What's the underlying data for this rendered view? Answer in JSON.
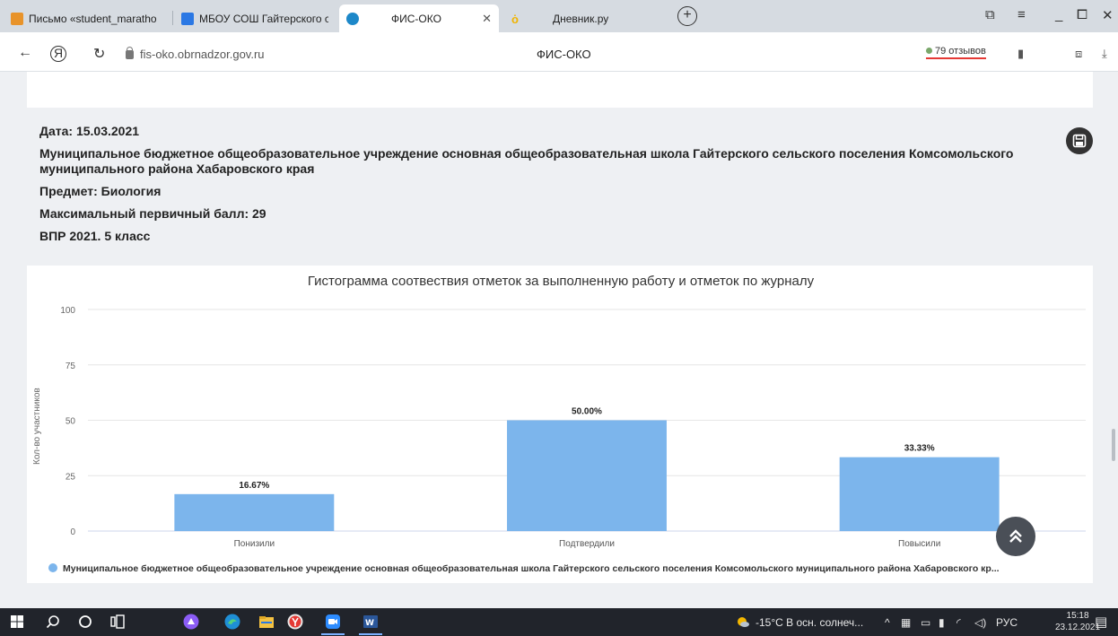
{
  "browser": {
    "tabs": [
      {
        "label": "Письмо «student_maratho",
        "color": "#e8932a"
      },
      {
        "label": "МБОУ СОШ Гайтерского с",
        "color": "#2b78e4"
      },
      {
        "label": "ФИС-ОКО",
        "color": "#1d88c9"
      },
      {
        "label": "Дневник.ру",
        "color": "#f0b400"
      }
    ],
    "url": "fis-oko.obrnadzor.gov.ru",
    "page_title": "ФИС-ОКО",
    "reviews": "79 отзывов"
  },
  "report": {
    "date": "Дата: 15.03.2021",
    "org": "Муниципальное бюджетное общеобразовательное учреждение основная общеобразовательная школа Гайтерского сельского поселения Комсомольского муниципального района Хабаровского края",
    "subject": "Предмет: Биология",
    "max_score": "Максимальный первичный балл: 29",
    "test": "ВПР 2021. 5 класс"
  },
  "chart_data": {
    "type": "bar",
    "title": "Гистограмма соотвествия отметок за выполненную работу и отметок по журналу",
    "ylabel": "Кол-во участников",
    "categories": [
      "Понизили",
      "Подтвердили",
      "Повысили"
    ],
    "series": [
      {
        "name": "Муниципальное бюджетное общеобразовательное учреждение основная общеобразовательная школа Гайтерского сельского поселения Комсомольского муниципального района Хабаровского кр...",
        "values": [
          16.67,
          50.0,
          33.33
        ],
        "labels": [
          "16.67%",
          "50.00%",
          "33.33%"
        ],
        "color": "#7cb5ec"
      }
    ],
    "ylim": [
      0,
      100
    ],
    "yticks": [
      "0",
      "25",
      "50",
      "75",
      "100"
    ],
    "grid": true,
    "legend": "bottom-left"
  },
  "taskbar": {
    "weather": "-15°C  В осн. солнеч...",
    "lang": "РУС",
    "time": "15:18",
    "date": "23.12.2021"
  }
}
